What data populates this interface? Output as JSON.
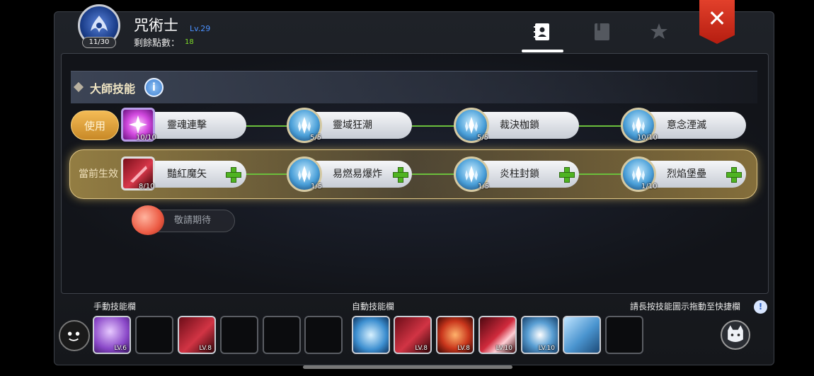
{
  "header": {
    "class_name": "咒術士",
    "class_level": "Lv.29",
    "level_count": "11/30",
    "points_label": "剩餘點數：",
    "points_value": "18",
    "tabs": [
      {
        "icon": "skill-book-icon",
        "active": true
      },
      {
        "icon": "journal-icon",
        "active": false
      },
      {
        "icon": "emblem-star-icon",
        "active": false
      }
    ],
    "close_icon": "close-icon"
  },
  "master": {
    "title": "大師技能",
    "info_label": "i",
    "use_label": "使用",
    "effect_label": "當前生效",
    "coming_soon": "敬請期待",
    "row1": [
      {
        "name": "靈魂連擊",
        "count": "10/10",
        "icon": "soul-combo-icon"
      },
      {
        "name": "靈域狂潮",
        "count": "5/5",
        "icon": "crystal-icon"
      },
      {
        "name": "裁決枷鎖",
        "count": "5/5",
        "icon": "crystal-icon"
      },
      {
        "name": "意念湮滅",
        "count": "10/10",
        "icon": "crystal-icon"
      }
    ],
    "row2": [
      {
        "name": "豔紅魔矢",
        "count": "8/10",
        "icon": "crimson-arrow-icon"
      },
      {
        "name": "易燃易爆炸",
        "count": "1/5",
        "icon": "crystal-icon"
      },
      {
        "name": "炎柱封鎖",
        "count": "1/5",
        "icon": "crystal-icon"
      },
      {
        "name": "烈焰堡壘",
        "count": "1/10",
        "icon": "crystal-icon"
      }
    ]
  },
  "bottom": {
    "manual_label": "手動技能欄",
    "auto_label": "自動技能欄",
    "hint": "請長按技能圖示拖動至快捷欄",
    "hint_icon": "!",
    "manual_slots": [
      {
        "lv": "LV.6",
        "kind": "purple"
      },
      {
        "lv": "",
        "kind": "empty"
      },
      {
        "lv": "LV.8",
        "kind": "red"
      },
      {
        "lv": "",
        "kind": "empty"
      },
      {
        "lv": "",
        "kind": "empty"
      },
      {
        "lv": "",
        "kind": "empty"
      }
    ],
    "auto_slots": [
      {
        "lv": "",
        "kind": "blue"
      },
      {
        "lv": "LV.8",
        "kind": "red"
      },
      {
        "lv": "LV.8",
        "kind": "fire"
      },
      {
        "lv": "LV.10",
        "kind": "red2"
      },
      {
        "lv": "LV.10",
        "kind": "blue2"
      },
      {
        "lv": "",
        "kind": "blue3"
      },
      {
        "lv": "",
        "kind": "empty"
      }
    ]
  }
}
